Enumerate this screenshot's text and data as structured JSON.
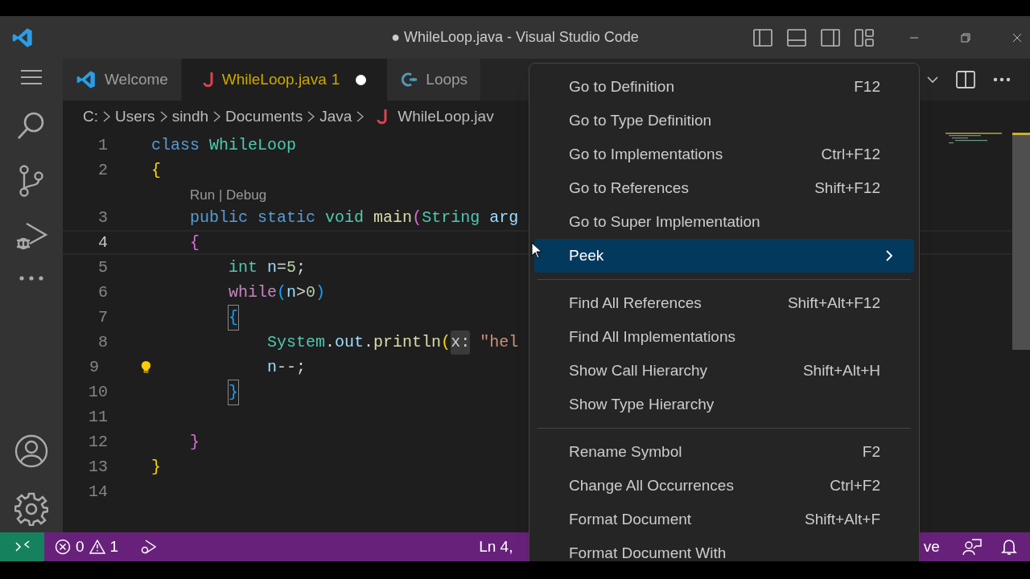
{
  "window": {
    "title": "● WhileLoop.java - Visual Studio Code"
  },
  "activity_bar": {
    "top": [
      {
        "kind": "menu"
      },
      {
        "kind": "search"
      },
      {
        "kind": "source-control"
      },
      {
        "kind": "run-debug"
      },
      {
        "kind": "more"
      }
    ],
    "bottom": [
      {
        "kind": "account"
      },
      {
        "kind": "settings"
      }
    ]
  },
  "tabs": [
    {
      "label": "Welcome",
      "kind": "welcome",
      "selected": false,
      "dirty": false
    },
    {
      "label": "WhileLoop.java",
      "kind": "java",
      "selected": true,
      "problems": "1",
      "dirty": true
    },
    {
      "label": "Loops",
      "kind": "cpp",
      "selected": false,
      "dirty": false
    }
  ],
  "breadcrumbs": [
    {
      "label": "C:",
      "kind": "folder"
    },
    {
      "label": "Users",
      "kind": "folder"
    },
    {
      "label": "sindh",
      "kind": "folder"
    },
    {
      "label": "Documents",
      "kind": "folder"
    },
    {
      "label": "Java",
      "kind": "folder"
    },
    {
      "label": "WhileLoop.jav",
      "kind": "java"
    }
  ],
  "editor": {
    "lines": [
      {
        "number": "1",
        "current": false,
        "lightbulb": false,
        "tokens": [
          {
            "kind": "kw",
            "text": "class"
          },
          {
            "kind": "type",
            "text": " WhileLoop"
          }
        ]
      },
      {
        "number": "2",
        "current": false,
        "lightbulb": false,
        "tokens": [
          {
            "kind": "b1",
            "text": "{"
          }
        ]
      },
      {
        "kind": "codelens",
        "text": "    Run | Debug"
      },
      {
        "number": "3",
        "current": false,
        "lightbulb": false,
        "tokens": [
          {
            "kind": "kw",
            "text": "    public"
          },
          {
            "kind": "kw",
            "text": " static"
          },
          {
            "kind": "type",
            "text": " void"
          },
          {
            "kind": "fn",
            "text": " main"
          },
          {
            "kind": "b2",
            "text": "("
          },
          {
            "kind": "type",
            "text": "String"
          },
          {
            "kind": "var",
            "text": " arg"
          }
        ]
      },
      {
        "number": "4",
        "current": true,
        "lightbulb": false,
        "tokens": [
          {
            "kind": "b2",
            "text": "    {"
          }
        ]
      },
      {
        "number": "5",
        "current": false,
        "lightbulb": false,
        "tokens": [
          {
            "kind": "type",
            "text": "        int"
          },
          {
            "kind": "var",
            "text": " n"
          },
          {
            "kind": "plain",
            "text": "="
          },
          {
            "kind": "num",
            "text": "5"
          },
          {
            "kind": "plain",
            "text": ";"
          }
        ]
      },
      {
        "number": "6",
        "current": false,
        "lightbulb": false,
        "tokens": [
          {
            "kind": "ctl",
            "text": "        while"
          },
          {
            "kind": "b3",
            "text": "("
          },
          {
            "kind": "var",
            "text": "n"
          },
          {
            "kind": "plain",
            "text": ">"
          },
          {
            "kind": "num",
            "text": "0"
          },
          {
            "kind": "b3",
            "text": ")"
          }
        ]
      },
      {
        "number": "7",
        "current": false,
        "lightbulb": false,
        "tokens": [
          {
            "kind": "b3box",
            "text": "        {"
          }
        ]
      },
      {
        "number": "8",
        "current": false,
        "lightbulb": false,
        "tokens": [
          {
            "kind": "type",
            "text": "            System"
          },
          {
            "kind": "plain",
            "text": "."
          },
          {
            "kind": "var",
            "text": "out"
          },
          {
            "kind": "plain",
            "text": "."
          },
          {
            "kind": "fn",
            "text": "println"
          },
          {
            "kind": "b1",
            "text": "("
          },
          {
            "kind": "hint",
            "text": "x:"
          },
          {
            "kind": "str",
            "text": " \"hel"
          }
        ]
      },
      {
        "number": "9",
        "current": false,
        "lightbulb": true,
        "tokens": [
          {
            "kind": "var",
            "text": "            n"
          },
          {
            "kind": "plain",
            "text": "--;"
          }
        ]
      },
      {
        "number": "10",
        "current": false,
        "lightbulb": false,
        "tokens": [
          {
            "kind": "b3box",
            "text": "        }"
          }
        ]
      },
      {
        "number": "11",
        "current": false,
        "lightbulb": false
      },
      {
        "number": "12",
        "current": false,
        "lightbulb": false,
        "tokens": [
          {
            "kind": "b2",
            "text": "    }"
          }
        ]
      },
      {
        "number": "13",
        "current": false,
        "lightbulb": false,
        "tokens": [
          {
            "kind": "b1",
            "text": "}"
          }
        ]
      },
      {
        "number": "14",
        "current": false,
        "lightbulb": false
      }
    ]
  },
  "context_menu": {
    "groups": [
      [
        {
          "label": "Go to Definition",
          "shortcut": "F12",
          "selected": false,
          "submenu": false
        },
        {
          "label": "Go to Type Definition",
          "selected": false,
          "submenu": false
        },
        {
          "label": "Go to Implementations",
          "shortcut": "Ctrl+F12",
          "selected": false,
          "submenu": false
        },
        {
          "label": "Go to References",
          "shortcut": "Shift+F12",
          "selected": false,
          "submenu": false
        },
        {
          "label": "Go to Super Implementation",
          "selected": false,
          "submenu": false
        },
        {
          "label": "Peek",
          "selected": true,
          "submenu": true
        }
      ],
      [
        {
          "label": "Find All References",
          "shortcut": "Shift+Alt+F12",
          "selected": false,
          "submenu": false
        },
        {
          "label": "Find All Implementations",
          "selected": false,
          "submenu": false
        },
        {
          "label": "Show Call Hierarchy",
          "shortcut": "Shift+Alt+H",
          "selected": false,
          "submenu": false
        },
        {
          "label": "Show Type Hierarchy",
          "selected": false,
          "submenu": false
        }
      ],
      [
        {
          "label": "Rename Symbol",
          "shortcut": "F2",
          "selected": false,
          "submenu": false
        },
        {
          "label": "Change All Occurrences",
          "shortcut": "Ctrl+F2",
          "selected": false,
          "submenu": false
        },
        {
          "label": "Format Document",
          "shortcut": "Shift+Alt+F",
          "selected": false,
          "submenu": false
        },
        {
          "label": "Format Document With",
          "selected": false,
          "submenu": false
        }
      ]
    ]
  },
  "status_bar": {
    "errors": "0",
    "warnings": "1",
    "position": "Ln 4, ",
    "right_text": "ve"
  }
}
